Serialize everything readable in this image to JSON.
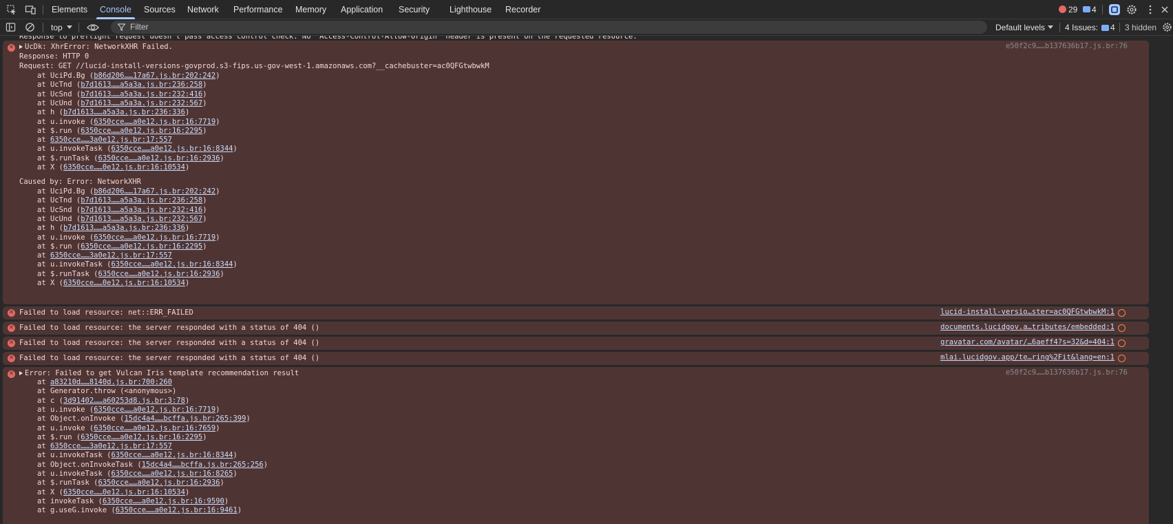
{
  "tabs": [
    "Elements",
    "Console",
    "Sources",
    "Network",
    "Performance",
    "Memory",
    "Application",
    "Security",
    "Lighthouse",
    "Recorder"
  ],
  "topbar": {
    "error_count": "29",
    "issue_count": "4"
  },
  "toolbar": {
    "context": "top",
    "filter_placeholder": "Filter",
    "levels": "Default levels",
    "issues_label": "4 Issues:",
    "issues_count": "4",
    "hidden": "3 hidden"
  },
  "console": {
    "clipped_line": "Response to preflight request doesn't pass access control check: No 'Access-Control-Allow-Origin' header is present on the requested resource.",
    "msg1": {
      "head": "UcDk: XhrError: NetworkXHR Failed.",
      "source": "e50f2c9……b137636b17.js.br:76",
      "response": "Response: HTTP 0",
      "request": "Request: GET //lucid-install-versions-govprod.s3-fips.us-gov-west-1.amazonaws.com?__cachebuster=ac0QFGtwbwkM",
      "stack": [
        {
          "pre": "at UciPd.Bg (",
          "link": "b86d206……17a67.js.br:202:242",
          "post": ")"
        },
        {
          "pre": "at UcTnd (",
          "link": "b7d1613……a5a3a.js.br:236:258",
          "post": ")"
        },
        {
          "pre": "at UcSnd (",
          "link": "b7d1613……a5a3a.js.br:232:416",
          "post": ")"
        },
        {
          "pre": "at UcUnd (",
          "link": "b7d1613……a5a3a.js.br:232:567",
          "post": ")"
        },
        {
          "pre": "at h (",
          "link": "b7d1613……a5a3a.js.br:236:336",
          "post": ")"
        },
        {
          "pre": "at u.invoke (",
          "link": "6350cce……a0e12.js.br:16:7719",
          "post": ")"
        },
        {
          "pre": "at $.run (",
          "link": "6350cce……a0e12.js.br:16:2295",
          "post": ")"
        },
        {
          "pre": "at ",
          "link": "6350cce……3a0e12.js.br:17:557",
          "post": ""
        },
        {
          "pre": "at u.invokeTask (",
          "link": "6350cce……a0e12.js.br:16:8344",
          "post": ")"
        },
        {
          "pre": "at $.runTask (",
          "link": "6350cce……a0e12.js.br:16:2936",
          "post": ")"
        },
        {
          "pre": "at X (",
          "link": "6350cce……0e12.js.br:16:10534",
          "post": ")"
        }
      ],
      "caused_by": "Caused by: Error: NetworkXHR",
      "stack2": [
        {
          "pre": "at UciPd.Bg (",
          "link": "b86d206……17a67.js.br:202:242",
          "post": ")"
        },
        {
          "pre": "at UcTnd (",
          "link": "b7d1613……a5a3a.js.br:236:258",
          "post": ")"
        },
        {
          "pre": "at UcSnd (",
          "link": "b7d1613……a5a3a.js.br:232:416",
          "post": ")"
        },
        {
          "pre": "at UcUnd (",
          "link": "b7d1613……a5a3a.js.br:232:567",
          "post": ")"
        },
        {
          "pre": "at h (",
          "link": "b7d1613……a5a3a.js.br:236:336",
          "post": ")"
        },
        {
          "pre": "at u.invoke (",
          "link": "6350cce……a0e12.js.br:16:7719",
          "post": ")"
        },
        {
          "pre": "at $.run (",
          "link": "6350cce……a0e12.js.br:16:2295",
          "post": ")"
        },
        {
          "pre": "at ",
          "link": "6350cce……3a0e12.js.br:17:557",
          "post": ""
        },
        {
          "pre": "at u.invokeTask (",
          "link": "6350cce……a0e12.js.br:16:8344",
          "post": ")"
        },
        {
          "pre": "at $.runTask (",
          "link": "6350cce……a0e12.js.br:16:2936",
          "post": ")"
        },
        {
          "pre": "at X (",
          "link": "6350cce……0e12.js.br:16:10534",
          "post": ")"
        }
      ]
    },
    "singles": [
      {
        "text": "Failed to load resource: net::ERR_FAILED",
        "source": "lucid-install-versio…ster=ac0QFGtwbwkM:1"
      },
      {
        "text": "Failed to load resource: the server responded with a status of 404 ()",
        "source": "documents.lucidgov.a…tributes/embedded:1"
      },
      {
        "text": "Failed to load resource: the server responded with a status of 404 ()",
        "source": "gravatar.com/avatar/…6aeff4?s=32&d=404:1"
      },
      {
        "text": "Failed to load resource: the server responded with a status of 404 ()",
        "source": "mlai.lucidgov.app/te…ring%2Fit&lang=en:1"
      }
    ],
    "msg2": {
      "head": "Error: Failed to get Vulcan Iris template recommendation result",
      "source": "e50f2c9……b137636b17.js.br:76",
      "stack": [
        {
          "pre": "at ",
          "link": "a83210d……8140d.js.br:700:260",
          "post": ""
        },
        {
          "pre": "at Generator.throw (<anonymous>)",
          "link": "",
          "post": ""
        },
        {
          "pre": "at c (",
          "link": "3d91402……a60253d8.js.br:3:78",
          "post": ")"
        },
        {
          "pre": "at u.invoke (",
          "link": "6350cce……a0e12.js.br:16:7719",
          "post": ")"
        },
        {
          "pre": "at Object.onInvoke (",
          "link": "15dc4a4……bcffa.js.br:265:399",
          "post": ")"
        },
        {
          "pre": "at u.invoke (",
          "link": "6350cce……a0e12.js.br:16:7659",
          "post": ")"
        },
        {
          "pre": "at $.run (",
          "link": "6350cce……a0e12.js.br:16:2295",
          "post": ")"
        },
        {
          "pre": "at ",
          "link": "6350cce……3a0e12.js.br:17:557",
          "post": ""
        },
        {
          "pre": "at u.invokeTask (",
          "link": "6350cce……a0e12.js.br:16:8344",
          "post": ")"
        },
        {
          "pre": "at Object.onInvokeTask (",
          "link": "15dc4a4……bcffa.js.br:265:256",
          "post": ")"
        },
        {
          "pre": "at u.invokeTask (",
          "link": "6350cce……a0e12.js.br:16:8265",
          "post": ")"
        },
        {
          "pre": "at $.runTask (",
          "link": "6350cce……a0e12.js.br:16:2936",
          "post": ")"
        },
        {
          "pre": "at X (",
          "link": "6350cce……0e12.js.br:16:10534",
          "post": ")"
        },
        {
          "pre": "at invokeTask (",
          "link": "6350cce……a0e12.js.br:16:9590",
          "post": ")"
        },
        {
          "pre": "at g.useG.invoke (",
          "link": "6350cce……a0e12.js.br:16:9461",
          "post": ")"
        }
      ]
    }
  }
}
